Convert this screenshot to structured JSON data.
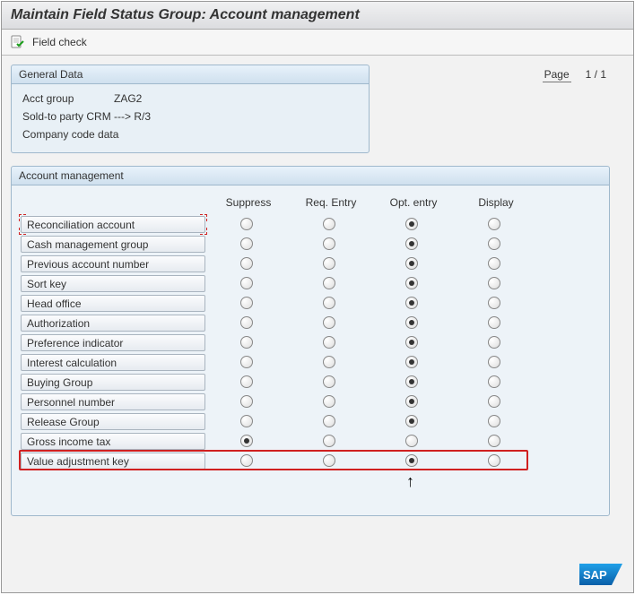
{
  "title": "Maintain Field Status Group: Account management",
  "toolbar": {
    "field_check": "Field check"
  },
  "general_data": {
    "header": "General Data",
    "acct_group_label": "Acct group",
    "acct_group_value": "ZAG2",
    "line2": "Sold-to party CRM ---> R/3",
    "line3": "Company code data"
  },
  "page": {
    "label": "Page",
    "value": "1  /  1"
  },
  "section": {
    "header": "Account management"
  },
  "columns": [
    "Suppress",
    "Req. Entry",
    "Opt. entry",
    "Display"
  ],
  "rows": [
    {
      "label": "Reconciliation account",
      "selected": 2,
      "focus": true
    },
    {
      "label": "Cash management group",
      "selected": 2
    },
    {
      "label": "Previous account number",
      "selected": 2
    },
    {
      "label": "Sort key",
      "selected": 2
    },
    {
      "label": "Head office",
      "selected": 2
    },
    {
      "label": "Authorization",
      "selected": 2
    },
    {
      "label": "Preference indicator",
      "selected": 2
    },
    {
      "label": "Interest calculation",
      "selected": 2
    },
    {
      "label": "Buying Group",
      "selected": 2
    },
    {
      "label": "Personnel number",
      "selected": 2
    },
    {
      "label": "Release Group",
      "selected": 2
    },
    {
      "label": "Gross income tax",
      "selected": 0
    },
    {
      "label": "Value adjustment key",
      "selected": 2,
      "highlight": true
    }
  ]
}
